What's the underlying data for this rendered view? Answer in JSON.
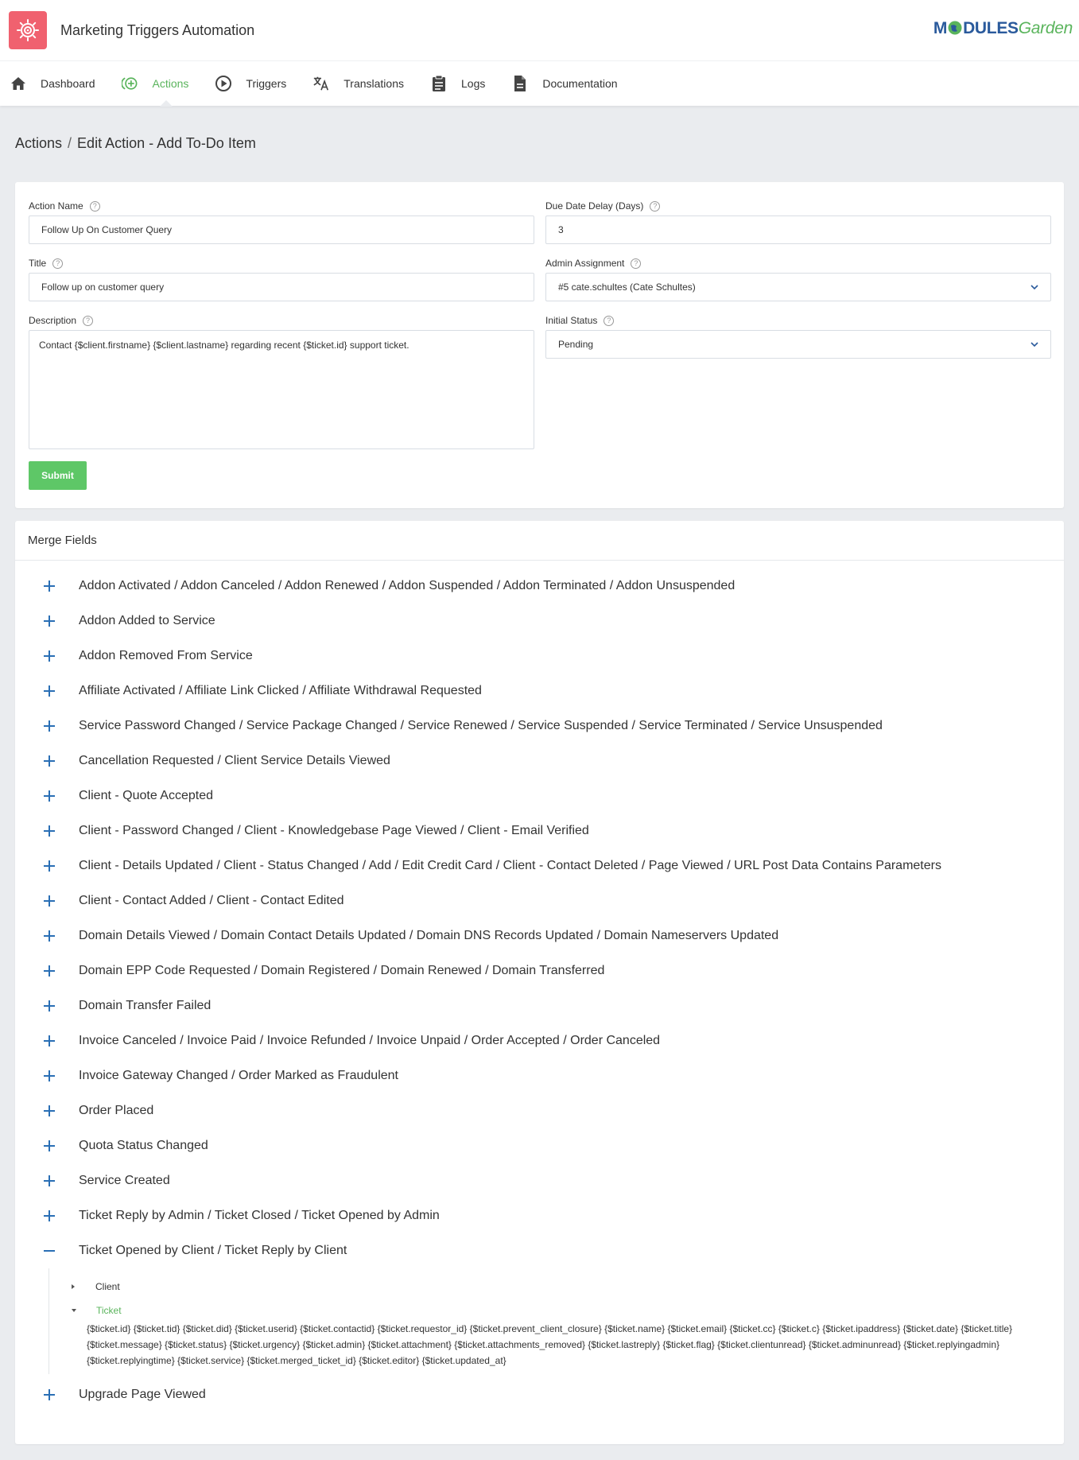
{
  "app": {
    "title": "Marketing Triggers Automation",
    "brand_part1": "M",
    "brand_part2": "DULES",
    "brand_part3": "Garden",
    "logo_color": "#f0616f",
    "accent_color": "#5ab45c"
  },
  "nav": {
    "items": [
      {
        "label": "Dashboard",
        "icon": "home-icon"
      },
      {
        "label": "Actions",
        "icon": "add-circle-icon"
      },
      {
        "label": "Triggers",
        "icon": "play-circle-icon"
      },
      {
        "label": "Translations",
        "icon": "translate-icon"
      },
      {
        "label": "Logs",
        "icon": "clipboard-icon"
      },
      {
        "label": "Documentation",
        "icon": "document-icon"
      }
    ]
  },
  "breadcrumb": {
    "root": "Actions",
    "separator": "/",
    "current": "Edit Action - Add To-Do Item"
  },
  "form": {
    "action_name_label": "Action Name",
    "action_name_value": "Follow Up On Customer Query",
    "title_label": "Title",
    "title_value": "Follow up on customer query",
    "description_label": "Description",
    "description_value": "Contact {$client.firstname} {$client.lastname} regarding recent {$ticket.id} support ticket.",
    "due_date_label": "Due Date Delay (Days)",
    "due_date_value": "3",
    "admin_label": "Admin Assignment",
    "admin_value": "#5 cate.schultes (Cate Schultes)",
    "status_label": "Initial Status",
    "status_value": "Pending",
    "help_glyph": "?",
    "submit_label": "Submit"
  },
  "merge": {
    "title": "Merge Fields",
    "groups_before": [
      "Addon Activated / Addon Canceled / Addon Renewed / Addon Suspended / Addon Terminated / Addon Unsuspended",
      "Addon Added to Service",
      "Addon Removed From Service",
      "Affiliate Activated / Affiliate Link Clicked / Affiliate Withdrawal Requested",
      "Service Password Changed / Service Package Changed / Service Renewed / Service Suspended / Service Terminated / Service Unsuspended",
      "Cancellation Requested / Client Service Details Viewed",
      "Client - Quote Accepted",
      "Client - Password Changed / Client - Knowledgebase Page Viewed / Client - Email Verified",
      "Client - Details Updated / Client - Status Changed / Add / Edit Credit Card / Client - Contact Deleted / Page Viewed / URL Post Data Contains Parameters",
      "Client - Contact Added / Client - Contact Edited",
      "Domain Details Viewed / Domain Contact Details Updated / Domain DNS Records Updated / Domain Nameservers Updated",
      "Domain EPP Code Requested / Domain Registered / Domain Renewed / Domain Transferred",
      "Domain Transfer Failed",
      "Invoice Canceled / Invoice Paid / Invoice Refunded / Invoice Unpaid / Order Accepted / Order Canceled",
      "Invoice Gateway Changed / Order Marked as Fraudulent",
      "Order Placed",
      "Quota Status Changed",
      "Service Created",
      "Ticket Reply by Admin / Ticket Closed / Ticket Opened by Admin"
    ],
    "expanded_group": "Ticket Opened by Client / Ticket Reply by Client",
    "sub_client": "Client",
    "sub_ticket": "Ticket",
    "ticket_fields": "{$ticket.id} {$ticket.tid} {$ticket.did} {$ticket.userid} {$ticket.contactid} {$ticket.requestor_id} {$ticket.prevent_client_closure} {$ticket.name} {$ticket.email} {$ticket.cc} {$ticket.c} {$ticket.ipaddress} {$ticket.date} {$ticket.title} {$ticket.message} {$ticket.status} {$ticket.urgency} {$ticket.admin} {$ticket.attachment} {$ticket.attachments_removed} {$ticket.lastreply} {$ticket.flag} {$ticket.clientunread} {$ticket.adminunread} {$ticket.replyingadmin} {$ticket.replyingtime} {$ticket.service} {$ticket.merged_ticket_id} {$ticket.editor} {$ticket.updated_at}",
    "group_after": "Upgrade Page Viewed"
  }
}
